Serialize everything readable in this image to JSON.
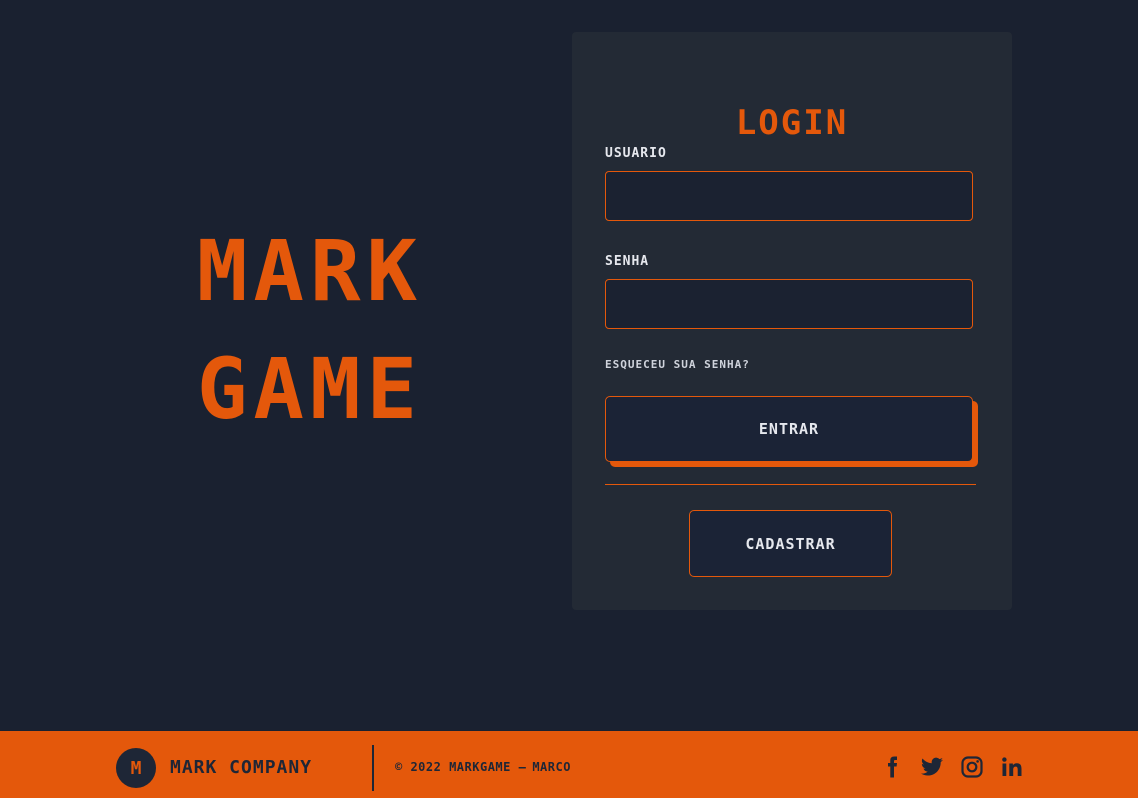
{
  "brand": {
    "line1": "MARK",
    "line2": "GAME"
  },
  "login": {
    "title": "LOGIN",
    "username_label": "USUARIO",
    "username_value": "",
    "password_label": "SENHA",
    "password_value": "",
    "forgot_label": "ESQUECEU SUA SENHA?",
    "enter_button": "ENTRAR",
    "register_button": "CADASTRAR"
  },
  "footer": {
    "logo_letter": "M",
    "company": "MARK COMPANY",
    "copyright": "© 2022 MARKGAME –",
    "author": "MARCO",
    "socials": [
      "facebook-icon",
      "twitter-icon",
      "instagram-icon",
      "linkedin-icon"
    ]
  },
  "colors": {
    "background": "#1a2130",
    "card": "#232a35",
    "accent": "#e4580b",
    "text": "#e6e8ee",
    "footer_text": "#1e2636"
  }
}
